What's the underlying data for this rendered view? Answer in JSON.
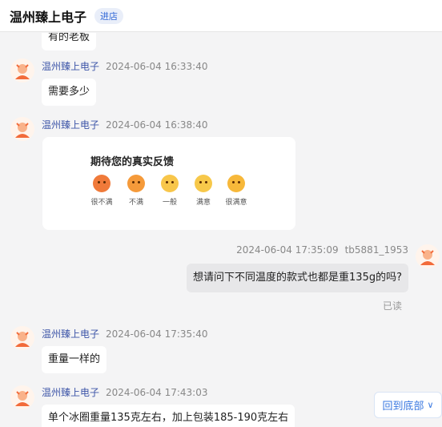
{
  "header": {
    "shop_name": "温州臻上电子",
    "enter_label": "进店"
  },
  "messages": [
    {
      "text": "有的老板"
    },
    {
      "sender": "温州臻上电子",
      "time": "2024-06-04 16:33:40",
      "text": "需要多少"
    },
    {
      "sender": "温州臻上电子",
      "time": "2024-06-04 16:38:40"
    },
    {
      "sender": "tb5881_1953",
      "time": "2024-06-04 17:35:09",
      "text": "想请问下不同温度的款式也都是重135g的吗?",
      "status": "已读"
    },
    {
      "sender": "温州臻上电子",
      "time": "2024-06-04 17:35:40",
      "text": "重量一样的"
    },
    {
      "sender": "温州臻上电子",
      "time": "2024-06-04 17:43:03",
      "text": "单个冰圈重量135克左右，加上包装185-190克左右"
    }
  ],
  "feedback": {
    "title": "期待您的真实反馈",
    "options": [
      {
        "label": "很不满",
        "icon": "very-unsatisfied-emoji-icon",
        "color": "#f07a3a"
      },
      {
        "label": "不满",
        "icon": "unsatisfied-emoji-icon",
        "color": "#f59a3a"
      },
      {
        "label": "一般",
        "icon": "neutral-emoji-icon",
        "color": "#f8c64a"
      },
      {
        "label": "满意",
        "icon": "satisfied-emoji-icon",
        "color": "#f7c84a"
      },
      {
        "label": "很满意",
        "icon": "very-satisfied-emoji-icon",
        "color": "#f7b83a"
      }
    ]
  },
  "controls": {
    "back_to_bottom": "回到底部"
  }
}
